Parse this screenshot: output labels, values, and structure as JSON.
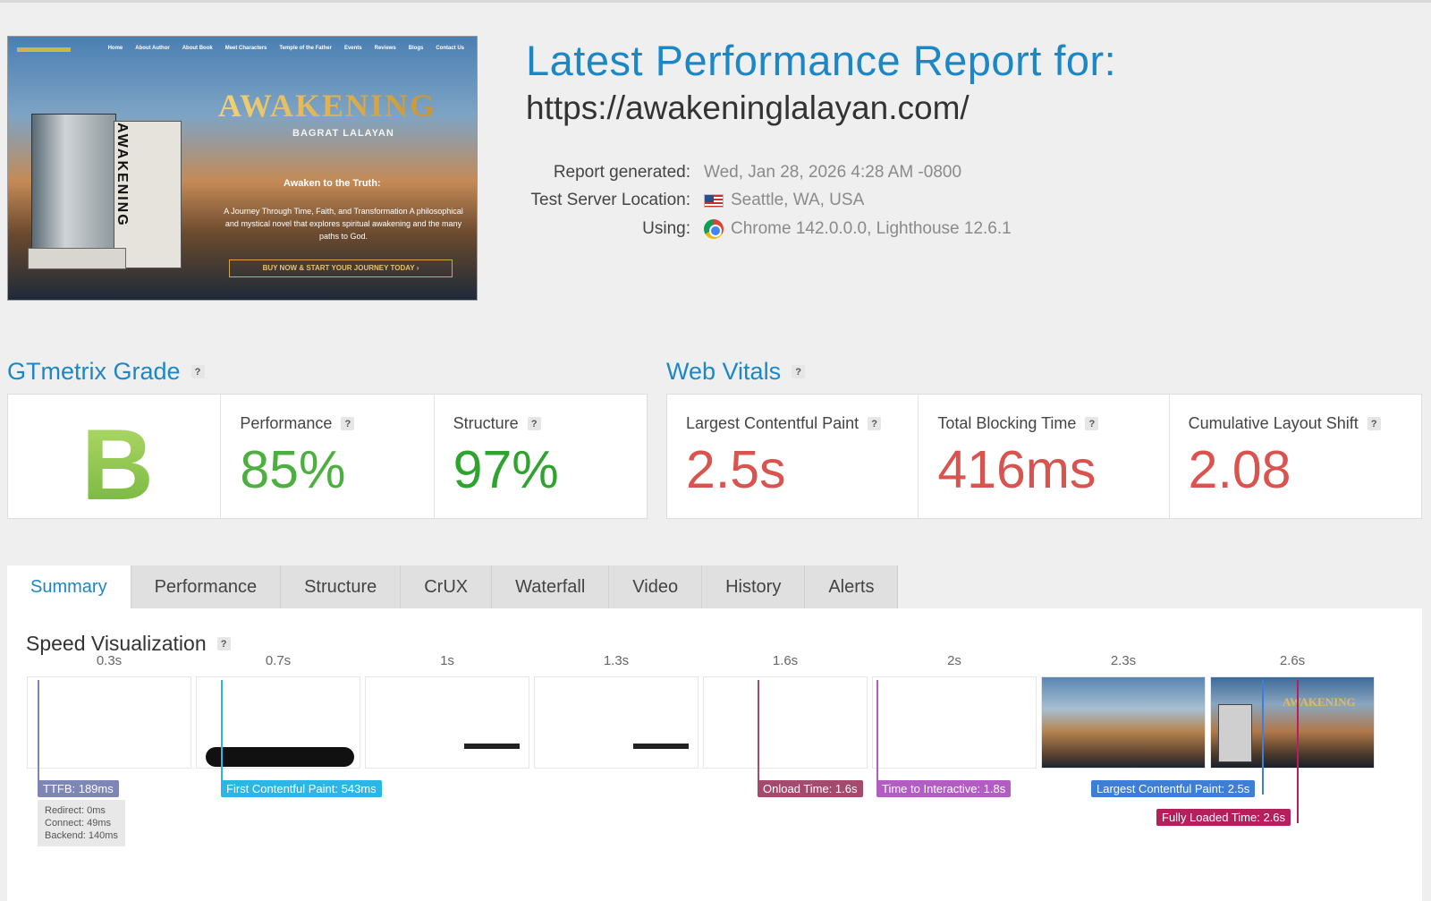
{
  "header": {
    "title": "Latest Performance Report for:",
    "url": "https://awakeninglalayan.com/",
    "meta": [
      {
        "label": "Report generated:",
        "value": "Wed, Jan 28, 2026 4:28 AM -0800",
        "icon": ""
      },
      {
        "label": "Test Server Location:",
        "value": "Seattle, WA, USA",
        "icon": "us-flag-icon"
      },
      {
        "label": "Using:",
        "value": "Chrome 142.0.0.0, Lighthouse 12.6.1",
        "icon": "chrome-icon"
      }
    ]
  },
  "thumbnail": {
    "nav": [
      "Home",
      "About Author",
      "About Book",
      "Meet Characters",
      "Temple of the Father",
      "Events",
      "Reviews",
      "Blogs",
      "Contact Us"
    ],
    "title": "AWAKENING",
    "spine": "AWAKENING",
    "author": "BAGRAT LALAYAN",
    "tagline": "Awaken to the Truth:",
    "description": "A Journey Through Time, Faith, and Transformation A philosophical and mystical novel that explores spiritual awakening and the many paths to God.",
    "cta": "BUY NOW & START YOUR JOURNEY TODAY ›"
  },
  "grade": {
    "title": "GTmetrix Grade",
    "help": "?",
    "letter": "B",
    "performance_label": "Performance",
    "performance_value": "85%",
    "structure_label": "Structure",
    "structure_value": "97%"
  },
  "vitals": {
    "title": "Web Vitals",
    "help": "?",
    "items": [
      {
        "label": "Largest Contentful Paint",
        "value": "2.5s"
      },
      {
        "label": "Total Blocking Time",
        "value": "416ms"
      },
      {
        "label": "Cumulative Layout Shift",
        "value": "2.08"
      }
    ]
  },
  "tabs": [
    "Summary",
    "Performance",
    "Structure",
    "CrUX",
    "Waterfall",
    "Video",
    "History",
    "Alerts"
  ],
  "speed": {
    "title": "Speed Visualization",
    "help": "?",
    "frame_times": [
      "0.3s",
      "0.7s",
      "1s",
      "1.3s",
      "1.6s",
      "2s",
      "2.3s",
      "2.6s"
    ],
    "frame_awakening_text": "AWAKENING",
    "markers": {
      "ttfb": "TTFB: 189ms",
      "ttfb_details": [
        "Redirect: 0ms",
        "Connect: 49ms",
        "Backend: 140ms"
      ],
      "fcp": "First Contentful Paint: 543ms",
      "onload": "Onload Time: 1.6s",
      "tti": "Time to Interactive: 1.8s",
      "lcp": "Largest Contentful Paint: 2.5s",
      "fully_loaded": "Fully Loaded Time: 2.6s"
    },
    "marker_colors": {
      "ttfb": "#7d86b5",
      "fcp": "#2ab7e8",
      "onload": "#a54a6e",
      "tti": "#b35dc4",
      "lcp": "#3d7fd6",
      "fully_loaded": "#b41f5c"
    }
  },
  "colors": {
    "accent": "#1b87c7",
    "grade_green": "#6fb33c",
    "good": "#4caf3f",
    "bad": "#d9534f"
  }
}
